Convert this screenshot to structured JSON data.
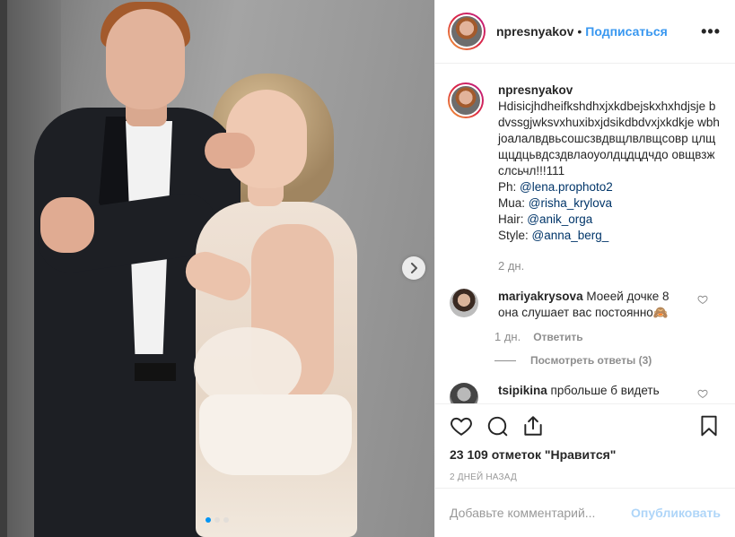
{
  "post": {
    "username": "npresnyakov",
    "separator": "•",
    "follow_label": "Подписаться",
    "more_label": "•••"
  },
  "caption": {
    "username": "npresnyakov",
    "text": "Hdisicjhdheifkshdhxjxkdbejskxhxhdjsje bdvssgjwksvxhuxibxjdsikdbdvxjxkdkje wbhjoалалвдвьсошсзвдвщлвлвщсовр цлщщцдцьвдсздвлаоуолдцдцдчдо овщвзжслсьчл!!!111",
    "credits": [
      {
        "label": "Ph: ",
        "handle": "@lena.prophoto2"
      },
      {
        "label": "Mua: ",
        "handle": "@risha_krylova"
      },
      {
        "label": "Hair: ",
        "handle": "@anik_orga"
      },
      {
        "label": "Style: ",
        "handle": "@anna_berg_"
      }
    ],
    "time": "2 дн."
  },
  "comments": [
    {
      "username": "mariyakrysova",
      "text": "Моеей дочке 8 она слушает вас постоянно🙈",
      "time": "1 дн.",
      "reply_label": "Ответить",
      "view_replies_label": "Посмотреть ответы (3)"
    },
    {
      "username": "tsipikina",
      "text": "прбольше б видеть"
    }
  ],
  "actions": {
    "like_icon": "heart-icon",
    "comment_icon": "comment-icon",
    "share_icon": "share-icon",
    "save_icon": "bookmark-icon"
  },
  "likes_text": "23 109 отметок \"Нравится\"",
  "posted_ago": "2 дней назад",
  "add_comment": {
    "placeholder": "Добавьте комментарий...",
    "publish_label": "Опубликовать"
  },
  "carousel": {
    "slide_count": 3,
    "active_index": 0
  },
  "colors": {
    "link_blue": "#3897f0",
    "mention_blue": "#003569",
    "active_dot": "#0095f6"
  }
}
